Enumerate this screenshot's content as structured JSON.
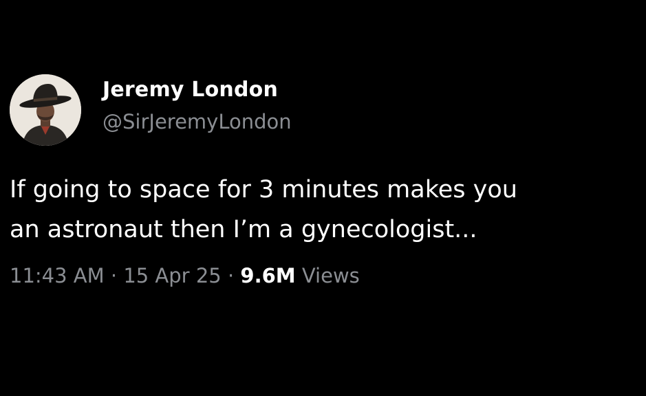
{
  "tweet": {
    "author": {
      "name": "Jeremy London",
      "handle": "@SirJeremyLondon"
    },
    "text_lines": [
      "If going to space for 3 minutes makes you",
      "an astronaut then I’m a gynecologist..."
    ],
    "meta": {
      "time": "11:43 AM",
      "separator": "·",
      "date": "15 Apr 25",
      "views_count": "9.6M",
      "views_label": "Views"
    }
  },
  "colors": {
    "background": "#000000",
    "primary_text": "#ffffff",
    "secondary_text": "#8b8e93"
  }
}
